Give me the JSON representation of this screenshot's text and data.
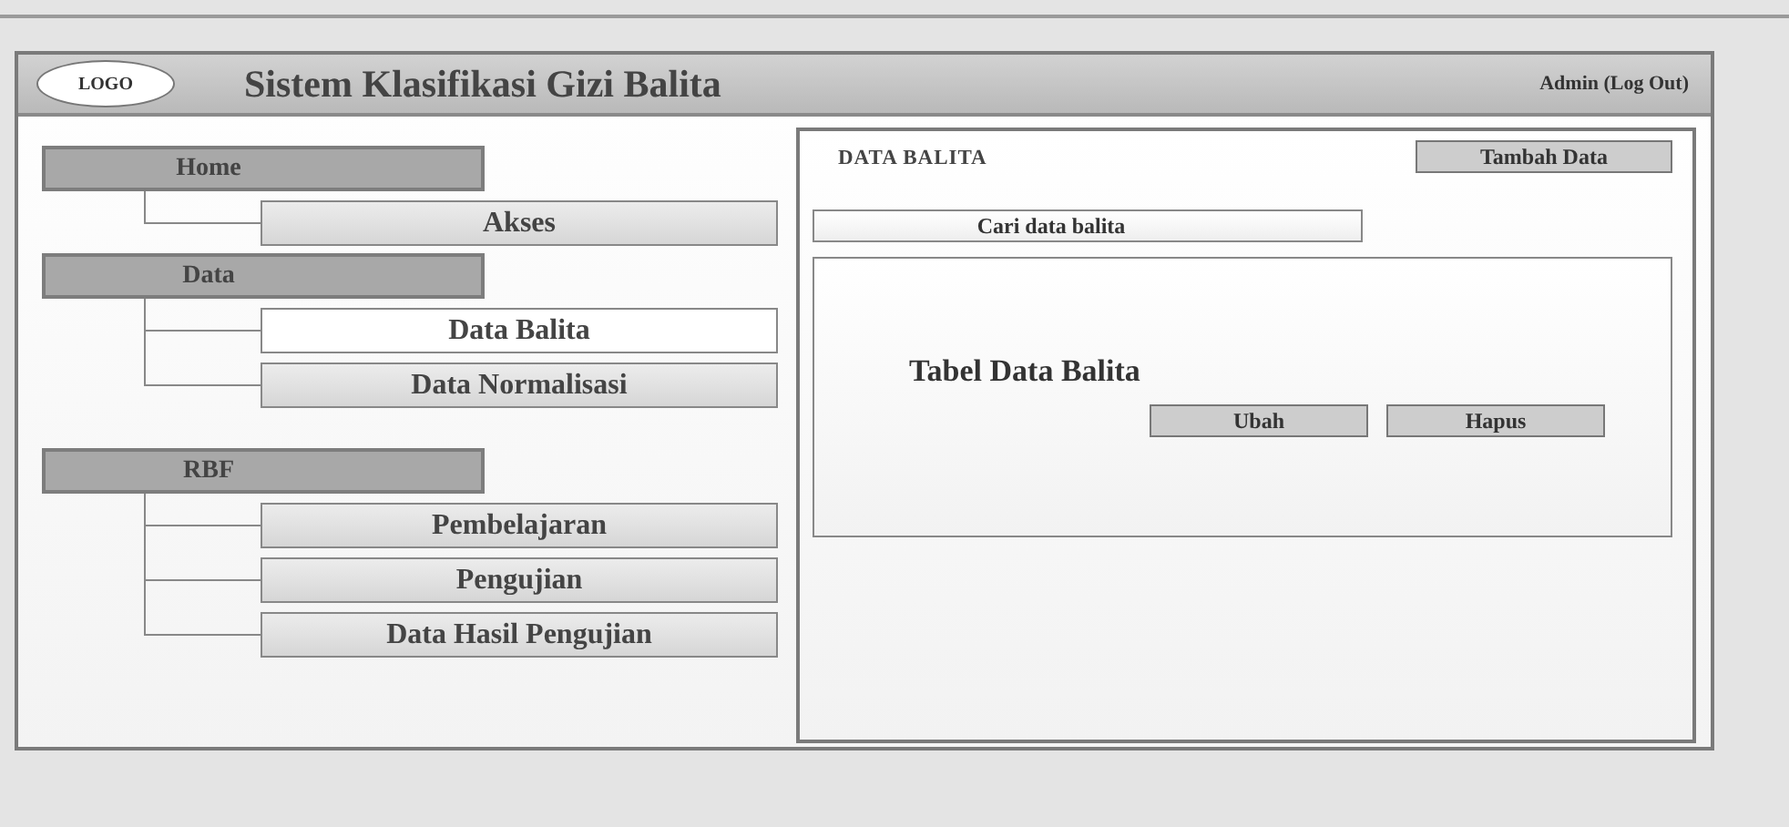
{
  "header": {
    "logo": "LOGO",
    "title": "Sistem Klasifikasi Gizi Balita",
    "user_link": "Admin (Log Out)"
  },
  "nav": [
    {
      "label": "Home",
      "children": [
        {
          "label": "Akses",
          "selected": false
        }
      ]
    },
    {
      "label": "Data",
      "children": [
        {
          "label": "Data Balita",
          "selected": true
        },
        {
          "label": "Data Normalisasi",
          "selected": false
        }
      ]
    },
    {
      "label": "RBF",
      "children": [
        {
          "label": "Pembelajaran",
          "selected": false
        },
        {
          "label": "Pengujian",
          "selected": false
        },
        {
          "label": "Data Hasil Pengujian",
          "selected": false
        }
      ]
    }
  ],
  "content": {
    "title": "DATA BALITA",
    "add_button": "Tambah Data",
    "search": {
      "placeholder": "Cari data balita"
    },
    "table_placeholder": "Tabel Data Balita",
    "row_buttons": [
      "Ubah",
      "Hapus"
    ]
  }
}
